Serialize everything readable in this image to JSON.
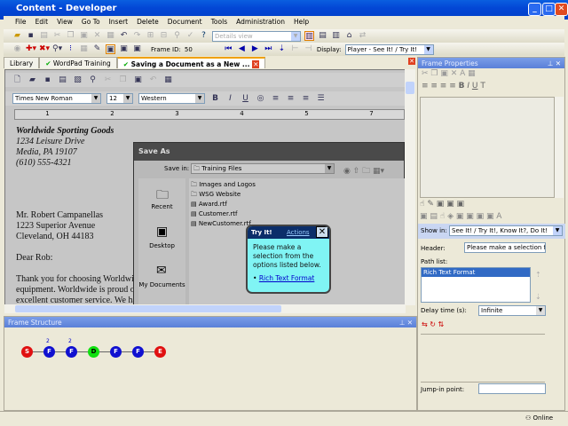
{
  "window": {
    "title": "Content - Developer"
  },
  "menu": [
    "File",
    "Edit",
    "View",
    "Go To",
    "Insert",
    "Delete",
    "Document",
    "Tools",
    "Administration",
    "Help"
  ],
  "toolbar": {
    "view_select": "Details view",
    "frame_id_label": "Frame ID:",
    "frame_id": "50",
    "display_label": "Display:",
    "display_value": "Player - See It! / Try It!"
  },
  "tabs": [
    {
      "label": "Library"
    },
    {
      "label": "WordPad Training"
    },
    {
      "label": "Saving a Document as a New ..."
    }
  ],
  "document": {
    "font": "Times New Roman",
    "size": "12",
    "script": "Western",
    "ruler": [
      "1",
      "2",
      "3",
      "4",
      "5",
      "7"
    ],
    "letter": [
      "Worldwide Sporting Goods",
      "1234 Leisure Drive",
      "Media, PA 19107",
      "(610) 555-4321",
      "Mr. Robert Campanellas",
      "1223 Superior Avenue",
      "Cleveland, OH  44183",
      "Dear Rob:",
      "Thank you for choosing Worldwide",
      "equipment. Worldwide is proud of",
      "excellent customer service.  We hav"
    ]
  },
  "save_as": {
    "title": "Save As",
    "save_in_label": "Save in:",
    "save_in": "Training Files",
    "places": [
      "Recent",
      "Desktop",
      "My Documents"
    ],
    "files": [
      "Images and Logos",
      "WSG Website",
      "Award.rtf",
      "Customer.rtf",
      "NewCustomer.rtf"
    ]
  },
  "tryit": {
    "title": "Try It!",
    "actions": "Actions",
    "message": "Please make a selection from the options listed below.",
    "option": "Rich Text Format"
  },
  "frame_structure": {
    "title": "Frame Structure",
    "nodes": [
      {
        "label": "S",
        "color": "#e01010",
        "badge": ""
      },
      {
        "label": "F",
        "color": "#1010d0",
        "badge": "2"
      },
      {
        "label": "F",
        "color": "#1010d0",
        "badge": "2"
      },
      {
        "label": "D",
        "color": "#10e010",
        "badge": ""
      },
      {
        "label": "F",
        "color": "#1010d0",
        "badge": ""
      },
      {
        "label": "F",
        "color": "#1010d0",
        "badge": ""
      },
      {
        "label": "E",
        "color": "#e01010",
        "badge": ""
      }
    ]
  },
  "frame_properties": {
    "title": "Frame Properties",
    "show_in_label": "Show in:",
    "show_in": "See It! / Try It!, Know It?, Do It!",
    "header_label": "Header:",
    "header_value": "Please make a selection from",
    "path_list_label": "Path list:",
    "path_list": [
      "Rich Text Format"
    ],
    "delay_label": "Delay time (s):",
    "delay_value": "Infinite",
    "jump_in_label": "Jump-in point:",
    "jump_in_value": ""
  },
  "status": {
    "online": "Online"
  }
}
